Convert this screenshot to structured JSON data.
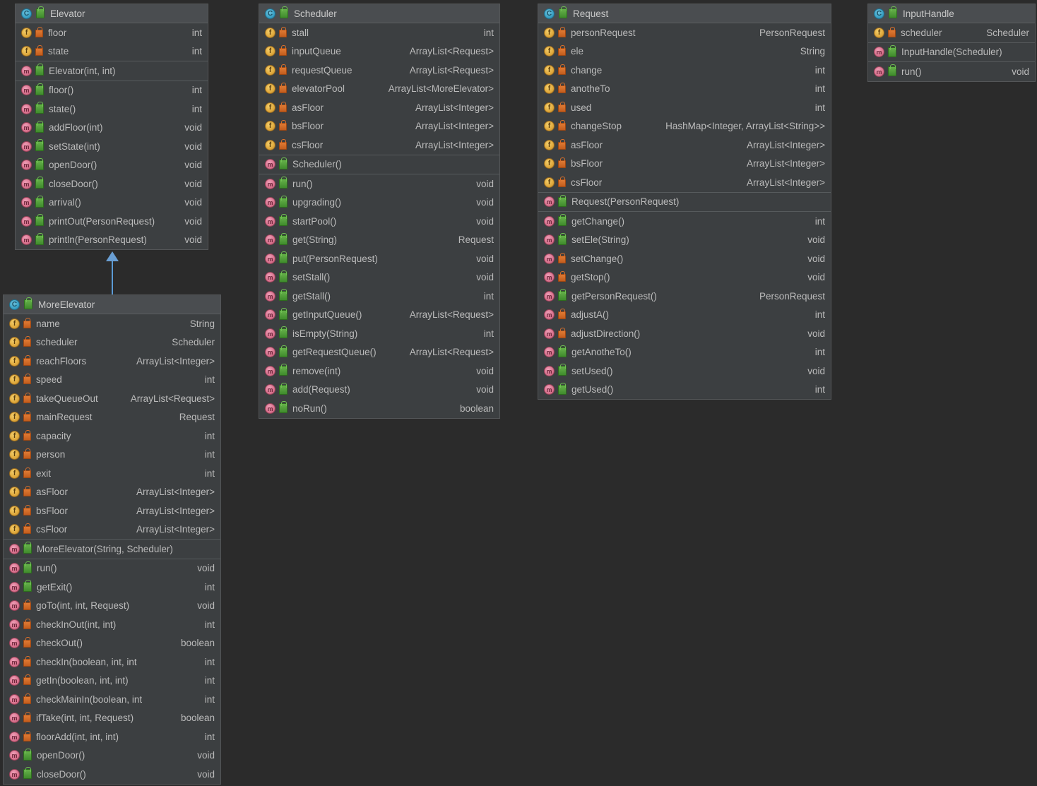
{
  "theme": {
    "background": "#2b2b2b",
    "panel_body": "#3c3f41",
    "panel_header": "#4a4d50",
    "panel_border": "#545658",
    "text": "#bbbbbb",
    "arrow": "#6a9fd4",
    "class_icon": "#39a0c4",
    "field_icon": "#e0a93c",
    "method_icon": "#d9738f",
    "public_icon": "#3f8b2c",
    "private_icon": "#c25c1d"
  },
  "icons": {
    "class": "class-circle-icon",
    "field": "field-circle-icon",
    "method": "method-circle-icon",
    "public": "public-visibility-icon",
    "private": "private-lock-icon"
  },
  "relations": [
    {
      "name": "inheritance-more-elevator-to-elevator",
      "from": "MoreElevator",
      "to": "Elevator",
      "kind": "generalization"
    }
  ],
  "classes": [
    {
      "name": "Elevator",
      "icon": "class",
      "sections": [
        {
          "kind": "fields",
          "rows": [
            {
              "icon": "field",
              "vis": "private",
              "label": "floor",
              "type": "int"
            },
            {
              "icon": "field",
              "vis": "private",
              "label": "state",
              "type": "int"
            }
          ]
        },
        {
          "kind": "constructors",
          "rows": [
            {
              "icon": "method",
              "vis": "public",
              "label": "Elevator(int, int)",
              "type": ""
            }
          ]
        },
        {
          "kind": "methods",
          "rows": [
            {
              "icon": "method",
              "vis": "public",
              "label": "floor()",
              "type": "int"
            },
            {
              "icon": "method",
              "vis": "public",
              "label": "state()",
              "type": "int"
            },
            {
              "icon": "method",
              "vis": "public",
              "label": "addFloor(int)",
              "type": "void"
            },
            {
              "icon": "method",
              "vis": "public",
              "label": "setState(int)",
              "type": "void"
            },
            {
              "icon": "method",
              "vis": "public",
              "label": "openDoor()",
              "type": "void"
            },
            {
              "icon": "method",
              "vis": "public",
              "label": "closeDoor()",
              "type": "void"
            },
            {
              "icon": "method",
              "vis": "public",
              "label": "arrival()",
              "type": "void"
            },
            {
              "icon": "method",
              "vis": "public",
              "label": "printOut(PersonRequest)",
              "type": "void"
            },
            {
              "icon": "method",
              "vis": "public",
              "label": "println(PersonRequest)",
              "type": "void"
            }
          ]
        }
      ]
    },
    {
      "name": "MoreElevator",
      "icon": "class",
      "sections": [
        {
          "kind": "fields",
          "rows": [
            {
              "icon": "field",
              "vis": "private",
              "label": "name",
              "type": "String"
            },
            {
              "icon": "field",
              "vis": "private",
              "label": "scheduler",
              "type": "Scheduler"
            },
            {
              "icon": "field",
              "vis": "private",
              "label": "reachFloors",
              "type": "ArrayList<Integer>"
            },
            {
              "icon": "field",
              "vis": "private",
              "label": "speed",
              "type": "int"
            },
            {
              "icon": "field",
              "vis": "private",
              "label": "takeQueueOut",
              "type": "ArrayList<Request>"
            },
            {
              "icon": "field",
              "vis": "private",
              "label": "mainRequest",
              "type": "Request"
            },
            {
              "icon": "field",
              "vis": "private",
              "label": "capacity",
              "type": "int"
            },
            {
              "icon": "field",
              "vis": "private",
              "label": "person",
              "type": "int"
            },
            {
              "icon": "field",
              "vis": "private",
              "label": "exit",
              "type": "int"
            },
            {
              "icon": "field",
              "vis": "private",
              "label": "asFloor",
              "type": "ArrayList<Integer>"
            },
            {
              "icon": "field",
              "vis": "private",
              "label": "bsFloor",
              "type": "ArrayList<Integer>"
            },
            {
              "icon": "field",
              "vis": "private",
              "label": "csFloor",
              "type": "ArrayList<Integer>"
            }
          ]
        },
        {
          "kind": "constructors",
          "rows": [
            {
              "icon": "method",
              "vis": "public",
              "label": "MoreElevator(String, Scheduler)",
              "type": ""
            }
          ]
        },
        {
          "kind": "methods",
          "rows": [
            {
              "icon": "method",
              "vis": "public",
              "label": "run()",
              "type": "void"
            },
            {
              "icon": "method",
              "vis": "public",
              "label": "getExit()",
              "type": "int"
            },
            {
              "icon": "method",
              "vis": "private",
              "label": "goTo(int, int, Request)",
              "type": "void"
            },
            {
              "icon": "method",
              "vis": "private",
              "label": "checkInOut(int, int)",
              "type": "int"
            },
            {
              "icon": "method",
              "vis": "private",
              "label": "checkOut()",
              "type": "boolean"
            },
            {
              "icon": "method",
              "vis": "private",
              "label": "checkIn(boolean, int, int",
              "type": "int"
            },
            {
              "icon": "method",
              "vis": "private",
              "label": "getIn(boolean, int, int)",
              "type": "int"
            },
            {
              "icon": "method",
              "vis": "private",
              "label": "checkMainIn(boolean, int",
              "type": "int"
            },
            {
              "icon": "method",
              "vis": "private",
              "label": "ifTake(int, int, Request)",
              "type": "boolean"
            },
            {
              "icon": "method",
              "vis": "private",
              "label": "floorAdd(int, int, int)",
              "type": "int"
            },
            {
              "icon": "method",
              "vis": "public",
              "label": "openDoor()",
              "type": "void"
            },
            {
              "icon": "method",
              "vis": "public",
              "label": "closeDoor()",
              "type": "void"
            }
          ]
        }
      ]
    },
    {
      "name": "Scheduler",
      "icon": "class",
      "sections": [
        {
          "kind": "fields",
          "rows": [
            {
              "icon": "field",
              "vis": "private",
              "label": "stall",
              "type": "int"
            },
            {
              "icon": "field",
              "vis": "private",
              "label": "inputQueue",
              "type": "ArrayList<Request>"
            },
            {
              "icon": "field",
              "vis": "private",
              "label": "requestQueue",
              "type": "ArrayList<Request>"
            },
            {
              "icon": "field",
              "vis": "private",
              "label": "elevatorPool",
              "type": "ArrayList<MoreElevator>"
            },
            {
              "icon": "field",
              "vis": "private",
              "label": "asFloor",
              "type": "ArrayList<Integer>"
            },
            {
              "icon": "field",
              "vis": "private",
              "label": "bsFloor",
              "type": "ArrayList<Integer>"
            },
            {
              "icon": "field",
              "vis": "private",
              "label": "csFloor",
              "type": "ArrayList<Integer>"
            }
          ]
        },
        {
          "kind": "constructors",
          "rows": [
            {
              "icon": "method",
              "vis": "public",
              "label": "Scheduler()",
              "type": ""
            }
          ]
        },
        {
          "kind": "methods",
          "rows": [
            {
              "icon": "method",
              "vis": "public",
              "label": "run()",
              "type": "void"
            },
            {
              "icon": "method",
              "vis": "public",
              "label": "upgrading()",
              "type": "void"
            },
            {
              "icon": "method",
              "vis": "public",
              "label": "startPool()",
              "type": "void"
            },
            {
              "icon": "method",
              "vis": "public",
              "label": "get(String)",
              "type": "Request"
            },
            {
              "icon": "method",
              "vis": "public",
              "label": "put(PersonRequest)",
              "type": "void"
            },
            {
              "icon": "method",
              "vis": "public",
              "label": "setStall()",
              "type": "void"
            },
            {
              "icon": "method",
              "vis": "public",
              "label": "getStall()",
              "type": "int"
            },
            {
              "icon": "method",
              "vis": "public",
              "label": "getInputQueue()",
              "type": "ArrayList<Request>"
            },
            {
              "icon": "method",
              "vis": "public",
              "label": "isEmpty(String)",
              "type": "int"
            },
            {
              "icon": "method",
              "vis": "public",
              "label": "getRequestQueue()",
              "type": "ArrayList<Request>"
            },
            {
              "icon": "method",
              "vis": "public",
              "label": "remove(int)",
              "type": "void"
            },
            {
              "icon": "method",
              "vis": "public",
              "label": "add(Request)",
              "type": "void"
            },
            {
              "icon": "method",
              "vis": "public",
              "label": "noRun()",
              "type": "boolean"
            }
          ]
        }
      ]
    },
    {
      "name": "Request",
      "icon": "class",
      "sections": [
        {
          "kind": "fields",
          "rows": [
            {
              "icon": "field",
              "vis": "private",
              "label": "personRequest",
              "type": "PersonRequest"
            },
            {
              "icon": "field",
              "vis": "private",
              "label": "ele",
              "type": "String"
            },
            {
              "icon": "field",
              "vis": "private",
              "label": "change",
              "type": "int"
            },
            {
              "icon": "field",
              "vis": "private",
              "label": "anotheTo",
              "type": "int"
            },
            {
              "icon": "field",
              "vis": "private",
              "label": "used",
              "type": "int"
            },
            {
              "icon": "field",
              "vis": "private",
              "label": "changeStop",
              "type": "HashMap<Integer, ArrayList<String>>"
            },
            {
              "icon": "field",
              "vis": "private",
              "label": "asFloor",
              "type": "ArrayList<Integer>"
            },
            {
              "icon": "field",
              "vis": "private",
              "label": "bsFloor",
              "type": "ArrayList<Integer>"
            },
            {
              "icon": "field",
              "vis": "private",
              "label": "csFloor",
              "type": "ArrayList<Integer>"
            }
          ]
        },
        {
          "kind": "constructors",
          "rows": [
            {
              "icon": "method",
              "vis": "public",
              "label": "Request(PersonRequest)",
              "type": ""
            }
          ]
        },
        {
          "kind": "methods",
          "rows": [
            {
              "icon": "method",
              "vis": "public",
              "label": "getChange()",
              "type": "int"
            },
            {
              "icon": "method",
              "vis": "public",
              "label": "setEle(String)",
              "type": "void"
            },
            {
              "icon": "method",
              "vis": "private",
              "label": "setChange()",
              "type": "void"
            },
            {
              "icon": "method",
              "vis": "private",
              "label": "getStop()",
              "type": "void"
            },
            {
              "icon": "method",
              "vis": "public",
              "label": "getPersonRequest()",
              "type": "PersonRequest"
            },
            {
              "icon": "method",
              "vis": "private",
              "label": "adjustA()",
              "type": "int"
            },
            {
              "icon": "method",
              "vis": "private",
              "label": "adjustDirection()",
              "type": "void"
            },
            {
              "icon": "method",
              "vis": "public",
              "label": "getAnotheTo()",
              "type": "int"
            },
            {
              "icon": "method",
              "vis": "public",
              "label": "setUsed()",
              "type": "void"
            },
            {
              "icon": "method",
              "vis": "public",
              "label": "getUsed()",
              "type": "int"
            }
          ]
        }
      ]
    },
    {
      "name": "InputHandle",
      "icon": "class",
      "sections": [
        {
          "kind": "fields",
          "rows": [
            {
              "icon": "field",
              "vis": "private",
              "label": "scheduler",
              "type": "Scheduler"
            }
          ]
        },
        {
          "kind": "constructors",
          "rows": [
            {
              "icon": "method",
              "vis": "public",
              "label": "InputHandle(Scheduler)",
              "type": ""
            }
          ]
        },
        {
          "kind": "methods",
          "rows": [
            {
              "icon": "method",
              "vis": "public",
              "label": "run()",
              "type": "void"
            }
          ]
        }
      ]
    }
  ]
}
